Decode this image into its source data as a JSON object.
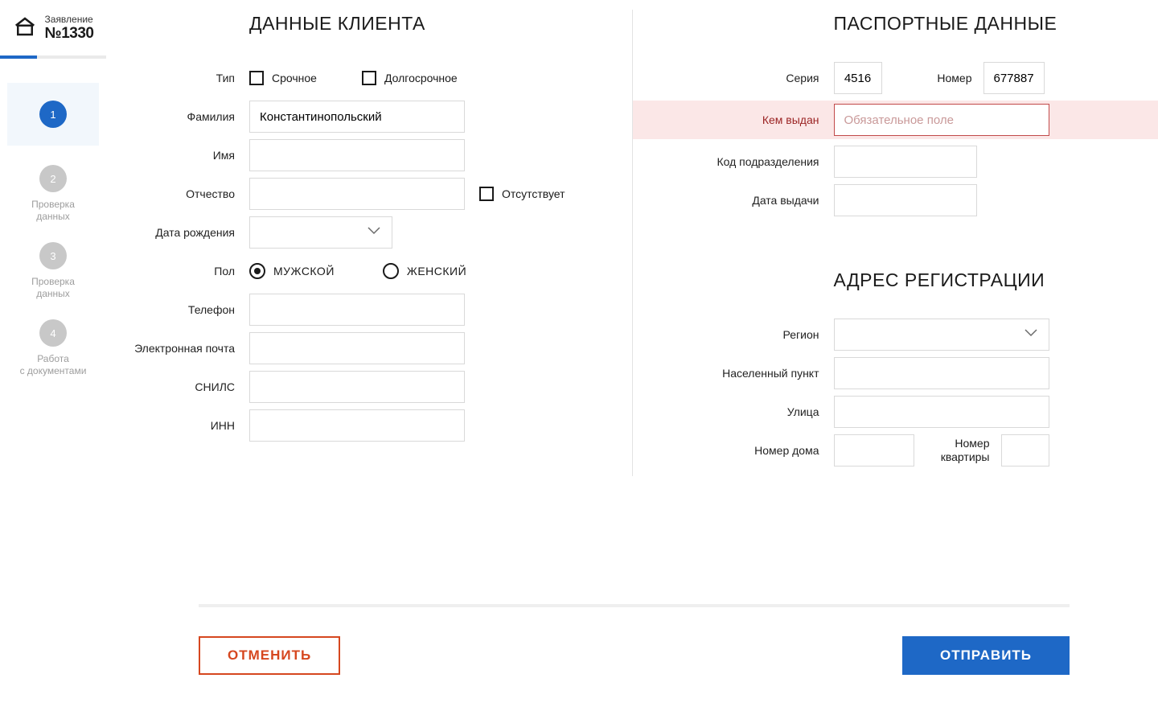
{
  "app": {
    "subtitle": "Заявление",
    "title": "№1330"
  },
  "steps": [
    {
      "num": "1",
      "label": ""
    },
    {
      "num": "2",
      "label": "Проверка\nданных"
    },
    {
      "num": "3",
      "label": "Проверка\nданных"
    },
    {
      "num": "4",
      "label": "Работа\nс документами"
    }
  ],
  "client": {
    "section_title": "ДАННЫЕ КЛИЕНТА",
    "labels": {
      "type": "Тип",
      "urgent": "Срочное",
      "longterm": "Долгосрочное",
      "lastname": "Фамилия",
      "firstname": "Имя",
      "patronymic": "Отчество",
      "absent": "Отсутствует",
      "birthdate": "Дата рождения",
      "gender": "Пол",
      "male": "МУЖСКОЙ",
      "female": "ЖЕНСКИЙ",
      "phone": "Телефон",
      "email": "Электронная почта",
      "snils": "СНИЛС",
      "inn": "ИНН"
    },
    "values": {
      "lastname": "Константинопольский",
      "firstname": "",
      "patronymic": "",
      "birthdate": "",
      "phone": "",
      "email": "",
      "snils": "",
      "inn": "",
      "gender": "male"
    }
  },
  "passport": {
    "section_title": "ПАСПОРТНЫЕ ДАННЫЕ",
    "labels": {
      "series": "Серия",
      "number": "Номер",
      "issued_by": "Кем выдан",
      "required_placeholder": "Обязательное поле",
      "division_code": "Код подразделения",
      "issue_date": "Дата выдачи"
    },
    "values": {
      "series": "4516",
      "number": "677887",
      "issued_by": "",
      "division_code": "",
      "issue_date": ""
    }
  },
  "address": {
    "section_title": "АДРЕС РЕГИСТРАЦИИ",
    "labels": {
      "region": "Регион",
      "locality": "Населенный пункт",
      "street": "Улица",
      "house": "Номер дома",
      "apartment": "Номер\nквартиры"
    },
    "values": {
      "region": "",
      "locality": "",
      "street": "",
      "house": "",
      "apartment": ""
    }
  },
  "footer": {
    "cancel": "ОТМЕНИТЬ",
    "submit": "ОТПРАВИТЬ"
  }
}
